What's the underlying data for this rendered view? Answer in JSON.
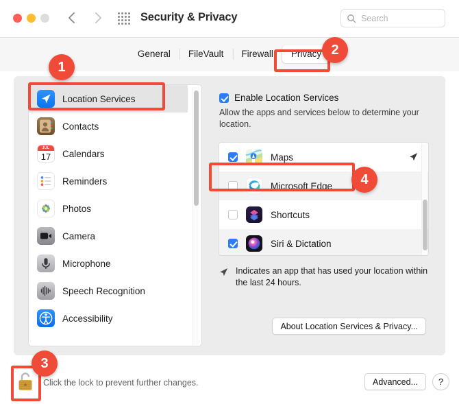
{
  "window": {
    "title": "Security & Privacy",
    "traffic_lights": [
      "close",
      "minimize",
      "maximize"
    ],
    "nav_back_icon": "chevron-left-icon",
    "nav_forward_icon": "chevron-right-icon",
    "grid_icon": "grid-of-dots-icon"
  },
  "search": {
    "placeholder": "Search",
    "value": "",
    "icon": "search-icon"
  },
  "tabs": [
    {
      "label": "General",
      "selected": false
    },
    {
      "label": "FileVault",
      "selected": false
    },
    {
      "label": "Firewall",
      "selected": false
    },
    {
      "label": "Privacy",
      "selected": true
    }
  ],
  "sidebar": {
    "items": [
      {
        "label": "Location Services",
        "icon": "location-arrow-icon",
        "selected": true
      },
      {
        "label": "Contacts",
        "icon": "contacts-icon",
        "selected": false
      },
      {
        "label": "Calendars",
        "icon": "calendar-icon",
        "selected": false
      },
      {
        "label": "Reminders",
        "icon": "reminders-icon",
        "selected": false
      },
      {
        "label": "Photos",
        "icon": "photos-icon",
        "selected": false
      },
      {
        "label": "Camera",
        "icon": "camera-icon",
        "selected": false
      },
      {
        "label": "Microphone",
        "icon": "microphone-icon",
        "selected": false
      },
      {
        "label": "Speech Recognition",
        "icon": "waveform-icon",
        "selected": false
      },
      {
        "label": "Accessibility",
        "icon": "accessibility-icon",
        "selected": false
      }
    ],
    "calendar_day": "17",
    "calendar_month": "JUL"
  },
  "main": {
    "enable_checkbox": {
      "label": "Enable Location Services",
      "checked": true
    },
    "description": "Allow the apps and services below to determine your location.",
    "apps": [
      {
        "name": "Maps",
        "checked": true,
        "recently_used": true,
        "icon": "maps-icon"
      },
      {
        "name": "Microsoft Edge",
        "checked": false,
        "recently_used": false,
        "icon": "edge-icon"
      },
      {
        "name": "Shortcuts",
        "checked": false,
        "recently_used": false,
        "icon": "shortcuts-icon"
      },
      {
        "name": "Siri & Dictation",
        "checked": true,
        "recently_used": false,
        "icon": "siri-icon"
      }
    ],
    "note": "Indicates an app that has used your location within the last 24 hours.",
    "note_icon": "location-arrow-icon",
    "about_button": "About Location Services & Privacy..."
  },
  "footer": {
    "lock_icon": "unlocked-padlock-icon",
    "lock_text": "Click the lock to prevent further changes.",
    "advanced_button": "Advanced...",
    "help_button": "?"
  },
  "annotations": {
    "accent_color": "#ef4b38",
    "badges": [
      {
        "number": "1",
        "target": "sidebar-item-location-services"
      },
      {
        "number": "2",
        "target": "tab-privacy"
      },
      {
        "number": "3",
        "target": "lock-icon"
      },
      {
        "number": "4",
        "target": "app-row-microsoft-edge"
      }
    ]
  }
}
